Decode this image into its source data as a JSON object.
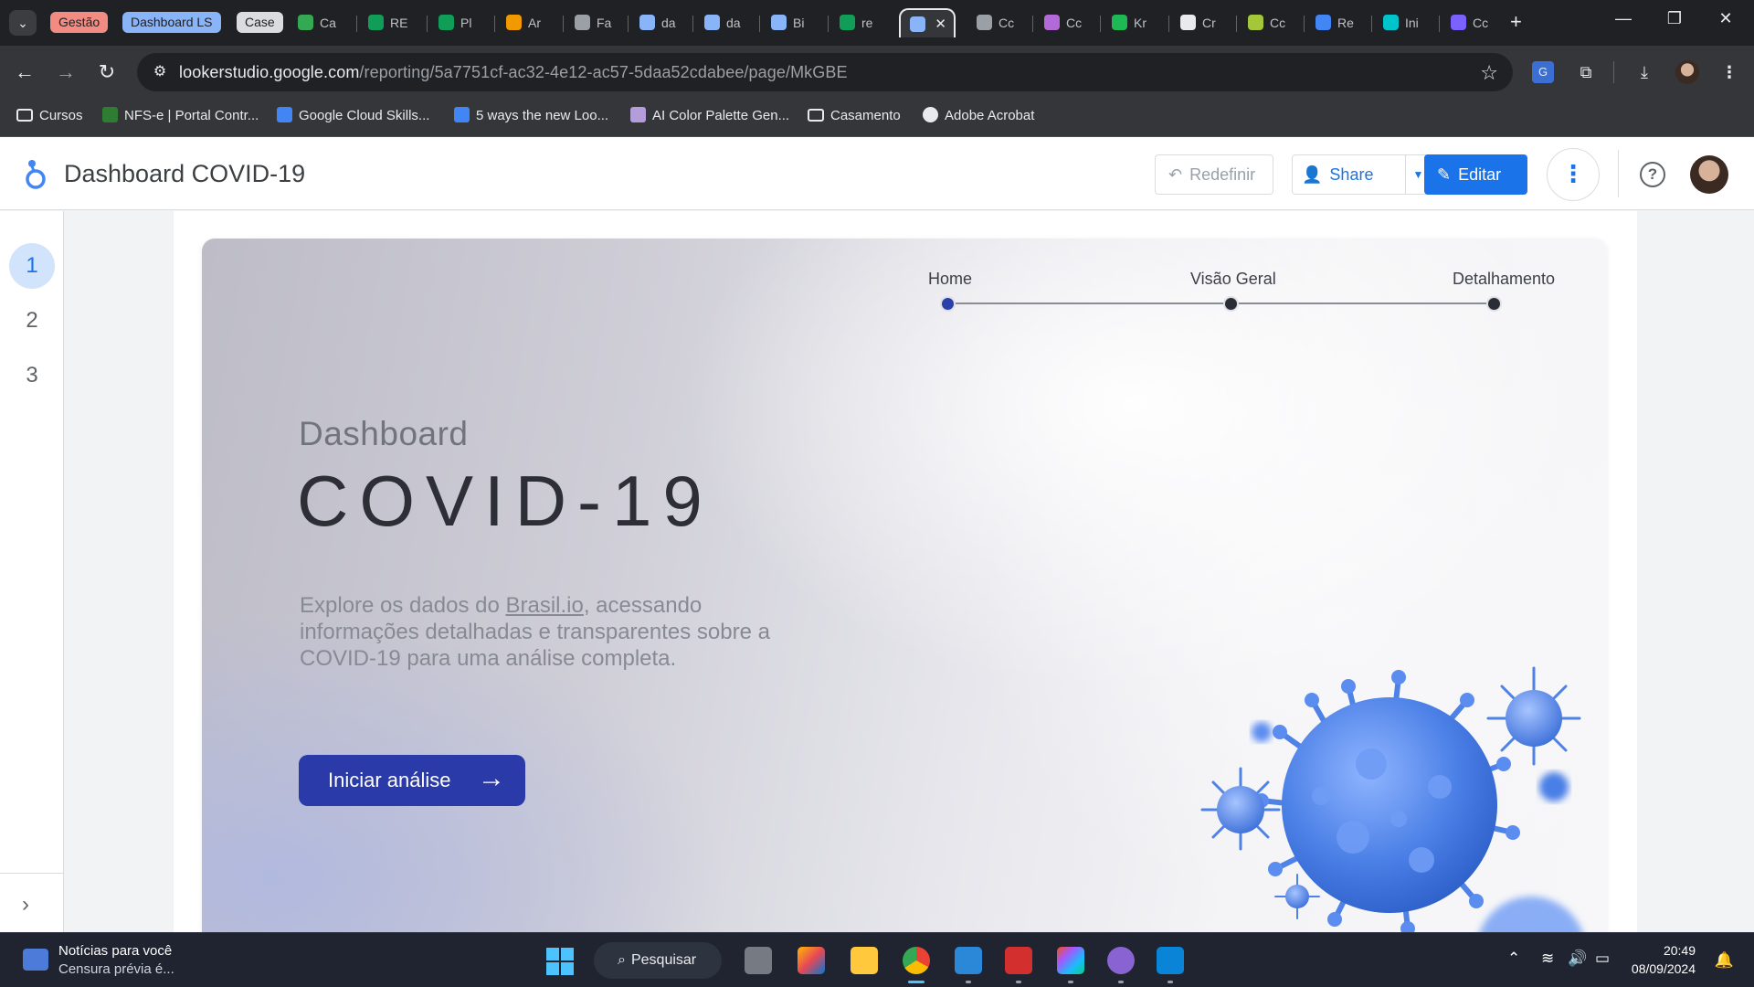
{
  "browser": {
    "tab_groups": [
      "Gestão",
      "Dashboard LS",
      "Case"
    ],
    "tabs": [
      {
        "label": "Ca",
        "icon": "google-drive-icon",
        "color": "#34a853"
      },
      {
        "label": "RE",
        "icon": "google-sheets-icon",
        "color": "#0f9d58"
      },
      {
        "label": "Pl",
        "icon": "google-sheets-icon",
        "color": "#0f9d58"
      },
      {
        "label": "Ar",
        "icon": "orange-app-icon",
        "color": "#f29900"
      },
      {
        "label": "Fa",
        "icon": "gear-like-icon",
        "color": "#9aa0a6"
      },
      {
        "label": "da",
        "icon": "dataset-icon",
        "color": "#8ab4f8"
      },
      {
        "label": "da",
        "icon": "json-braces-icon",
        "color": "#8ab4f8"
      },
      {
        "label": "Bi",
        "icon": "bigquery-icon",
        "color": "#8ab4f8"
      },
      {
        "label": "re",
        "icon": "google-sheets-icon",
        "color": "#0f9d58"
      },
      {
        "label": "",
        "icon": "looker-studio-icon",
        "color": "#8ab4f8",
        "active": true
      },
      {
        "label": "Cc",
        "icon": "lens-icon",
        "color": "#9aa0a6"
      },
      {
        "label": "Cc",
        "icon": "purple-app-icon",
        "color": "#b36ad9"
      },
      {
        "label": "Kr",
        "icon": "spotify-icon",
        "color": "#1db954"
      },
      {
        "label": "Cr",
        "icon": "openai-icon",
        "color": "#e8eaed"
      },
      {
        "label": "Cc",
        "icon": "colorful-app-icon",
        "color": "#a4c639"
      },
      {
        "label": "Re",
        "icon": "google-icon",
        "color": "#4285f4"
      },
      {
        "label": "Ini",
        "icon": "canva-icon",
        "color": "#00c4cc"
      },
      {
        "label": "Cc",
        "icon": "video-app-icon",
        "color": "#7b61ff"
      }
    ],
    "close_tab": "✕",
    "new_tab": "+",
    "url_host": "lookerstudio.google.com",
    "url_path": "/reporting/5a7751cf-ac32-4e12-ac57-5daa52cdabee/page/MkGBE",
    "bookmarks": [
      {
        "label": "Cursos",
        "icon": "folder-icon"
      },
      {
        "label": "NFS-e | Portal Contr...",
        "icon": "nfse-icon"
      },
      {
        "label": "Google Cloud Skills...",
        "icon": "google-cloud-icon"
      },
      {
        "label": "5 ways the new Loo...",
        "icon": "google-cloud-icon"
      },
      {
        "label": "AI Color Palette Gen...",
        "icon": "droplet-icon"
      },
      {
        "label": "Casamento",
        "icon": "folder-icon"
      },
      {
        "label": "Adobe Acrobat",
        "icon": "globe-icon"
      }
    ]
  },
  "looker": {
    "report_title": "Dashboard COVID-19",
    "reset_label": "Redefinir",
    "share_label": "Share",
    "edit_label": "Editar",
    "pages": [
      "1",
      "2",
      "3"
    ],
    "active_page": "1"
  },
  "report": {
    "nav": [
      "Home",
      "Visão Geral",
      "Detalhamento"
    ],
    "nav_active": "Home",
    "heading_small": "Dashboard",
    "heading_big": "COVID-19",
    "desc_before": "Explore os dados do ",
    "desc_link": "Brasil.io",
    "desc_after": ", acessando informações detalhadas e transparentes sobre a COVID-19 para uma análise completa.",
    "cta_label": "Iniciar análise",
    "accent": "#2a3aa8"
  },
  "taskbar": {
    "news_title": "Notícias para você",
    "news_sub": "Censura prévia é...",
    "search_label": "Pesquisar",
    "time": "20:49",
    "date": "08/09/2024"
  }
}
